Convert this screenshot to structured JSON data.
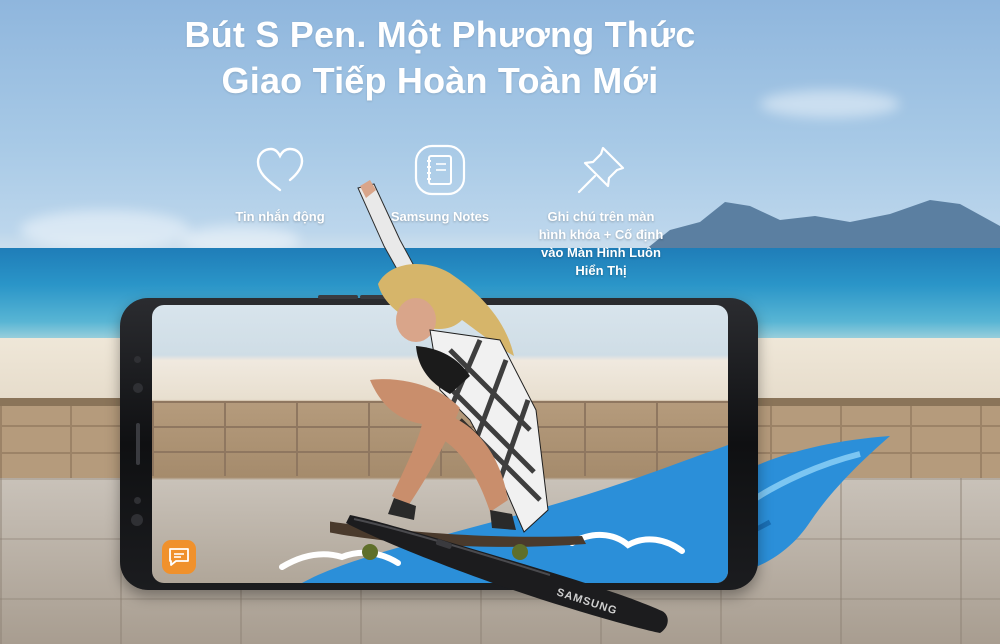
{
  "headline": {
    "line1": "Bút S Pen. Một Phương Thức",
    "line2": "Giao Tiếp Hoàn Toàn Mới"
  },
  "features": [
    {
      "icon": "heart-icon",
      "label": "Tin nhắn động"
    },
    {
      "icon": "notes-icon",
      "label": "Samsung Notes"
    },
    {
      "icon": "pin-icon",
      "label_lines": [
        "Ghi chú trên màn",
        "hình khóa + Cố định",
        "vào Màn Hình Luôn",
        "Hiển Thị"
      ]
    }
  ],
  "pen": {
    "brand": "SAMSUNG"
  },
  "colors": {
    "accent_orange": "#f0912c",
    "wave_blue": "#2b8fd9",
    "text_white": "#ffffff"
  }
}
